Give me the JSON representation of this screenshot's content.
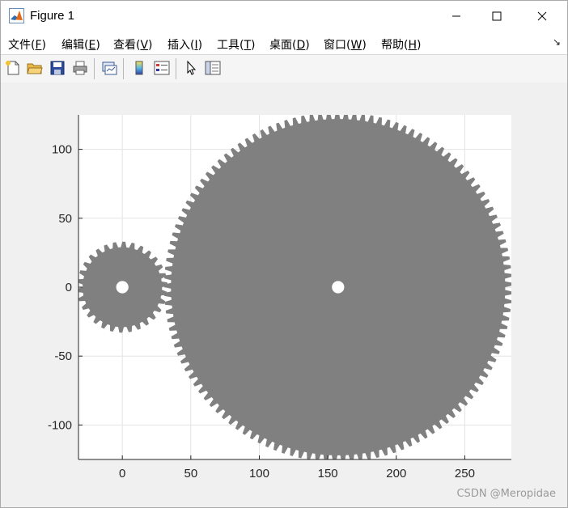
{
  "window": {
    "title": "Figure 1",
    "controls": {
      "minimize": "—",
      "maximize": "☐",
      "close": "✕"
    }
  },
  "menu": {
    "items": [
      {
        "label": "文件(",
        "key": "F",
        "tail": ")"
      },
      {
        "label": "编辑(",
        "key": "E",
        "tail": ")"
      },
      {
        "label": "查看(",
        "key": "V",
        "tail": ")"
      },
      {
        "label": "插入(",
        "key": "I",
        "tail": ")"
      },
      {
        "label": "工具(",
        "key": "T",
        "tail": ")"
      },
      {
        "label": "桌面(",
        "key": "D",
        "tail": ")"
      },
      {
        "label": "窗口(",
        "key": "W",
        "tail": ")"
      },
      {
        "label": "帮助(",
        "key": "H",
        "tail": ")"
      }
    ],
    "dock_icon": "↘"
  },
  "toolbar": {
    "buttons": [
      {
        "icon": "new-figure-icon"
      },
      {
        "icon": "open-file-icon"
      },
      {
        "icon": "save-icon"
      },
      {
        "icon": "print-icon"
      },
      {
        "icon": "link-plot-icon"
      },
      {
        "icon": "colorbar-icon"
      },
      {
        "icon": "legend-icon"
      },
      {
        "icon": "edit-plot-cursor-icon"
      },
      {
        "icon": "property-inspector-icon"
      }
    ]
  },
  "chart_data": {
    "type": "scatter",
    "description_shapes": [
      {
        "name": "small gear",
        "center": [
          0,
          0
        ],
        "outer_radius": 33,
        "root_radius": 29,
        "teeth": 30,
        "hole_radius": 4.5
      },
      {
        "name": "large gear",
        "center": [
          157.5,
          0
        ],
        "outer_radius": 127,
        "root_radius": 122,
        "teeth": 125,
        "hole_radius": 4.5
      }
    ],
    "xlim": [
      -32,
      284
    ],
    "ylim": [
      -125,
      125
    ],
    "xticks": [
      0,
      50,
      100,
      150,
      200,
      250
    ],
    "yticks": [
      -100,
      -50,
      0,
      50,
      100
    ],
    "xtick_labels": [
      "0",
      "50",
      "100",
      "150",
      "200",
      "250"
    ],
    "ytick_labels": [
      "-100",
      "-50",
      "0",
      "50",
      "100"
    ],
    "grid": true,
    "fill_color": "#808080",
    "title": "",
    "xlabel": "",
    "ylabel": ""
  },
  "watermark": "CSDN @Meropidae"
}
